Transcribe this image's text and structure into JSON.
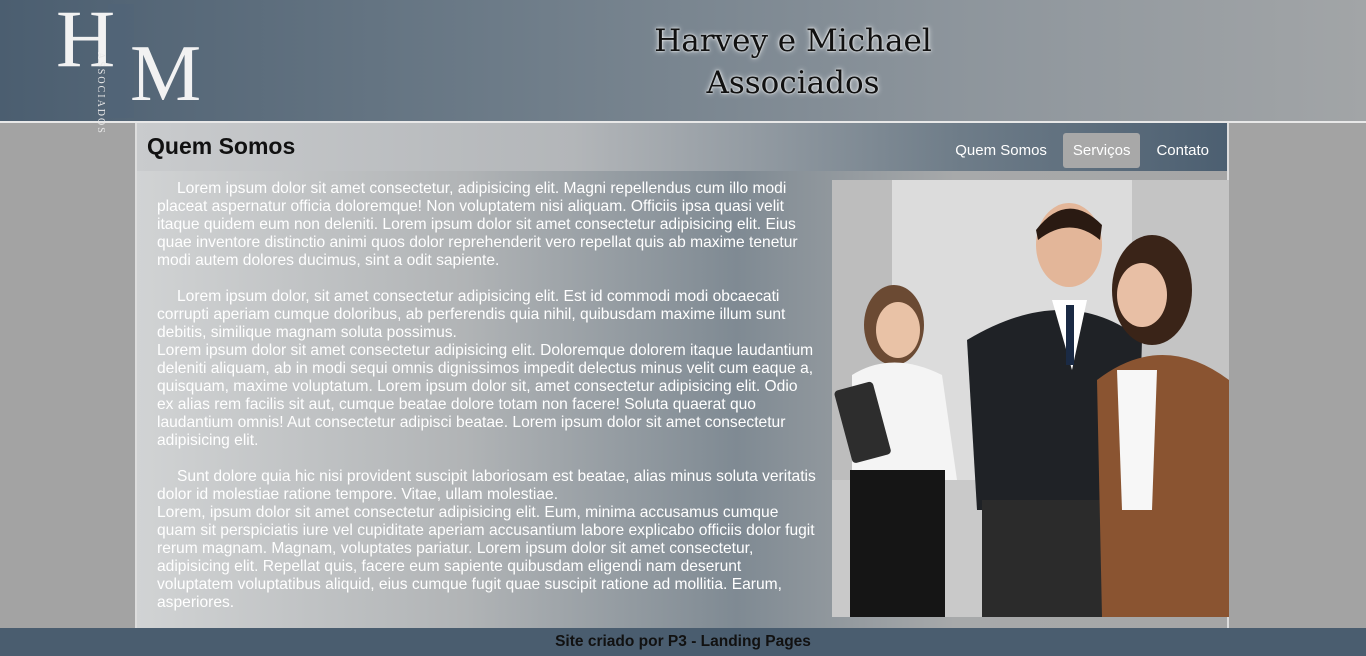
{
  "header": {
    "logo_h": "H",
    "logo_m": "M",
    "logo_vertical": "ASSOCIADOS",
    "brand_line1": "Harvey e Michael",
    "brand_line2": "Associados"
  },
  "section": {
    "title": "Quem Somos"
  },
  "nav": {
    "items": [
      {
        "label": "Quem Somos"
      },
      {
        "label": "Serviços"
      },
      {
        "label": "Contato"
      }
    ]
  },
  "content": {
    "p1": "Lorem ipsum dolor sit amet consectetur, adipisicing elit. Magni repellendus cum illo modi placeat aspernatur officia doloremque! Non voluptatem nisi aliquam. Officiis ipsa quasi velit itaque quidem eum non deleniti. Lorem ipsum dolor sit amet consectetur adipisicing elit. Eius quae inventore distinctio animi quos dolor reprehenderit vero repellat quis ab maxime tenetur modi autem dolores ducimus, sint a odit sapiente.",
    "p2a": "Lorem ipsum dolor, sit amet consectetur adipisicing elit. Est id commodi modi obcaecati corrupti aperiam cumque doloribus, ab perferendis quia nihil, quibusdam maxime illum sunt debitis, similique magnam soluta possimus.",
    "p2b": "Lorem ipsum dolor sit amet consectetur adipisicing elit. Doloremque dolorem itaque laudantium deleniti aliquam, ab in modi sequi omnis dignissimos impedit delectus minus velit cum eaque a, quisquam, maxime voluptatum. Lorem ipsum dolor sit, amet consectetur adipisicing elit. Odio ex alias rem facilis sit aut, cumque beatae dolore totam non facere! Soluta quaerat quo laudantium omnis! Aut consectetur adipisci beatae. Lorem ipsum dolor sit amet consectetur adipisicing elit.",
    "p3a": "Sunt dolore quia hic nisi provident suscipit laboriosam est beatae, alias minus soluta veritatis dolor id molestiae ratione tempore. Vitae, ullam molestiae.",
    "p3b": "Lorem, ipsum dolor sit amet consectetur adipisicing elit. Eum, minima accusamus cumque quam sit perspiciatis iure vel cupiditate aperiam accusantium labore explicabo officiis dolor fugit rerum magnam. Magnam, voluptates pariatur. Lorem ipsum dolor sit amet consectetur, adipisicing elit. Repellat quis, facere eum sapiente quibusdam eligendi nam deserunt voluptatem voluptatibus aliquid, eius cumque fugit quae suscipit ratione ad mollitia. Earum, asperiores."
  },
  "footer": {
    "text": "Site criado por P3 - Landing Pages"
  }
}
